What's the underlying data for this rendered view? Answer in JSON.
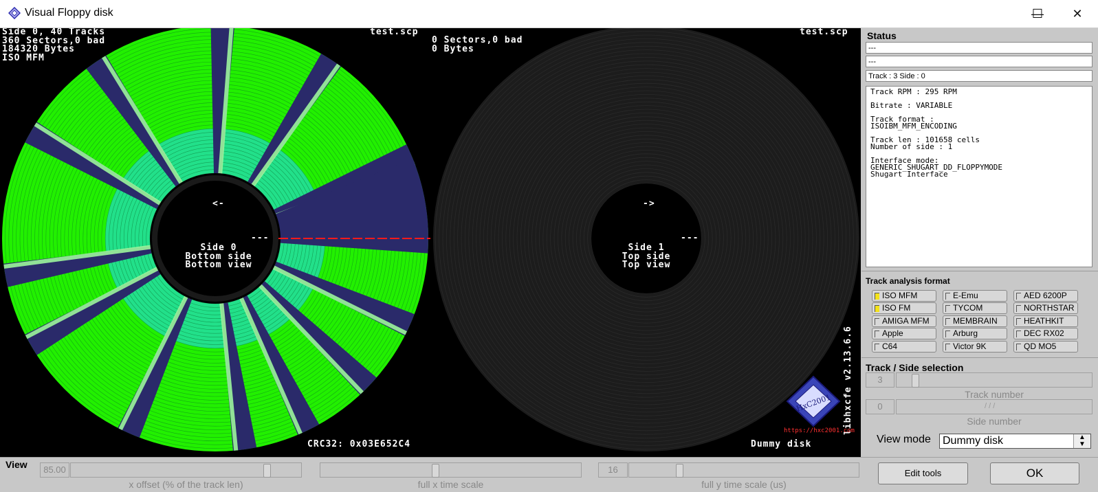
{
  "window": {
    "title": "Visual Floppy disk",
    "minimize_glyph": "—",
    "maximize_glyph": "☐",
    "close_glyph": "✕"
  },
  "disk_view": {
    "side0_info": [
      "Side 0, 40 Tracks",
      "360 Sectors,0 bad",
      "184320 Bytes",
      "ISO MFM"
    ],
    "side0_filename": "test.scp",
    "side1_info": [
      "0 Sectors,0 bad",
      "0 Bytes"
    ],
    "side1_filename": "test.scp",
    "side0_arrow": "<-",
    "side0_labels": [
      "Side 0",
      "Bottom side",
      "Bottom view"
    ],
    "side0_dash": "---",
    "side1_arrow": "->",
    "side1_labels": [
      "Side 1",
      "Top side",
      "Top view"
    ],
    "side1_dash": "---",
    "crc": "CRC32: 0x03E652C4",
    "side1_name": "Dummy disk",
    "version_text": "libhxcfe v2.13.6.6",
    "logo_text": "HxC2001",
    "url": "https://hxc2001.com",
    "colors": {
      "sector": "#22f000",
      "gap": "#2a2a6a",
      "header": "#9cf59c",
      "inner_band": "#22e08a",
      "empty_disk": "#1c1c1c"
    }
  },
  "status": {
    "title": "Status",
    "field1": "---",
    "field2": "---",
    "field3": "Track : 3 Side : 0",
    "details": [
      [
        "Track RPM : 295 RPM"
      ],
      [
        "Bitrate : VARIABLE"
      ],
      [
        "Track format :",
        "ISOIBM_MFM_ENCODING"
      ],
      [
        "Track len : 101658 cells",
        "Number of side : 1"
      ],
      [
        "Interface mode:",
        "GENERIC_SHUGART_DD_FLOPPYMODE",
        "Shugart Interface"
      ]
    ]
  },
  "track_analysis": {
    "title": "Track analysis format",
    "columns": [
      [
        {
          "label": "ISO MFM",
          "on": true
        },
        {
          "label": "ISO FM",
          "on": true
        },
        {
          "label": "AMIGA MFM",
          "on": false
        },
        {
          "label": "Apple",
          "on": false
        },
        {
          "label": "C64",
          "on": false
        }
      ],
      [
        {
          "label": "E-Emu",
          "on": false
        },
        {
          "label": "TYCOM",
          "on": false
        },
        {
          "label": "MEMBRAIN",
          "on": false
        },
        {
          "label": "Arburg",
          "on": false
        },
        {
          "label": "Victor 9K",
          "on": false
        }
      ],
      [
        {
          "label": "AED 6200P",
          "on": false
        },
        {
          "label": "NORTHSTAR",
          "on": false
        },
        {
          "label": "HEATHKIT",
          "on": false
        },
        {
          "label": "DEC RX02",
          "on": false
        },
        {
          "label": "QD MO5",
          "on": false
        }
      ]
    ]
  },
  "track_side": {
    "title": "Track / Side selection",
    "track_value": "3",
    "track_label": "Track number",
    "side_value": "0",
    "side_label": "Side number",
    "view_mode_label": "View mode",
    "view_mode_value": "Dummy disk"
  },
  "view": {
    "title": "View",
    "x_offset_value": "85.00",
    "x_offset_label": "x offset (% of the track len)",
    "x_offset_fraction": 0.86,
    "x_time_label": "full x time scale",
    "x_time_fraction": 0.44,
    "y_time_value": "16",
    "y_time_label": "full y time scale (us)",
    "y_time_fraction": 0.21,
    "edit_tools": "Edit tools",
    "ok": "OK"
  }
}
